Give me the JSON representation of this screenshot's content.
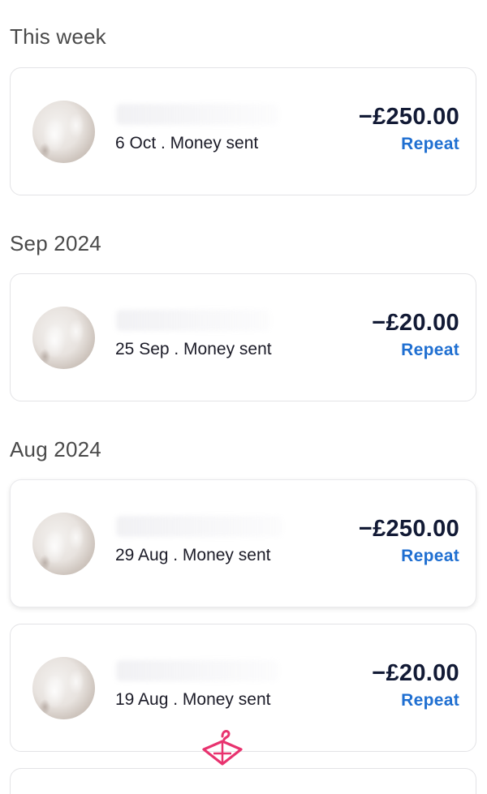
{
  "sections": [
    {
      "title": "This week",
      "transactions": [
        {
          "subtitle": "6 Oct . Money sent",
          "amount": "−£250.00",
          "action": "Repeat"
        }
      ]
    },
    {
      "title": "Sep 2024",
      "transactions": [
        {
          "subtitle": "25 Sep . Money sent",
          "amount": "−£20.00",
          "action": "Repeat"
        }
      ]
    },
    {
      "title": "Aug 2024",
      "transactions": [
        {
          "subtitle": "29 Aug . Money sent",
          "amount": "−£250.00",
          "action": "Repeat"
        },
        {
          "subtitle": "19 Aug . Money sent",
          "amount": "−£20.00",
          "action": "Repeat"
        }
      ]
    }
  ],
  "colors": {
    "accent": "#1f6fd1",
    "amount": "#121a35",
    "section_title": "#4a4a4a",
    "watermark": "#e8336f"
  },
  "icons": {
    "watermark": "hanger-logo-icon"
  }
}
